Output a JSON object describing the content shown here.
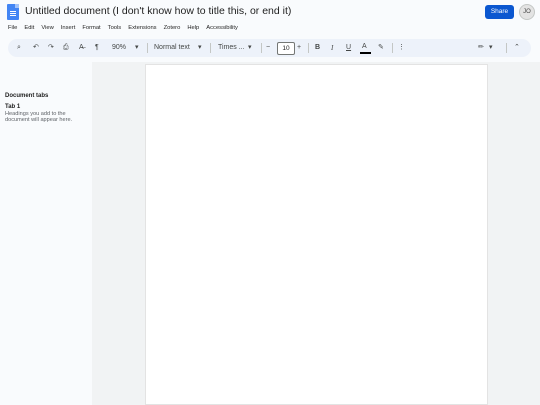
{
  "title": "Untitled document (I don't know how to title this, or end it)",
  "share_label": "Share",
  "avatar_initials": "JO",
  "menu": [
    "File",
    "Edit",
    "View",
    "Insert",
    "Format",
    "Tools",
    "Extensions",
    "Zotero",
    "Help",
    "Accessibility"
  ],
  "toolbar": {
    "zoom": "90%",
    "style": "Normal text",
    "font": "Times ...",
    "font_size": "10",
    "minus": "−",
    "plus": "+",
    "bold": "B",
    "italic": "I",
    "underline": "U",
    "text_color": "A"
  },
  "sidebar": {
    "heading": "Document tabs",
    "tab": "Tab 1",
    "hint": "Headings you add to the document will appear here."
  },
  "colors": {
    "share": "#0b57d0",
    "toolbar_bg": "#edf2fa"
  }
}
